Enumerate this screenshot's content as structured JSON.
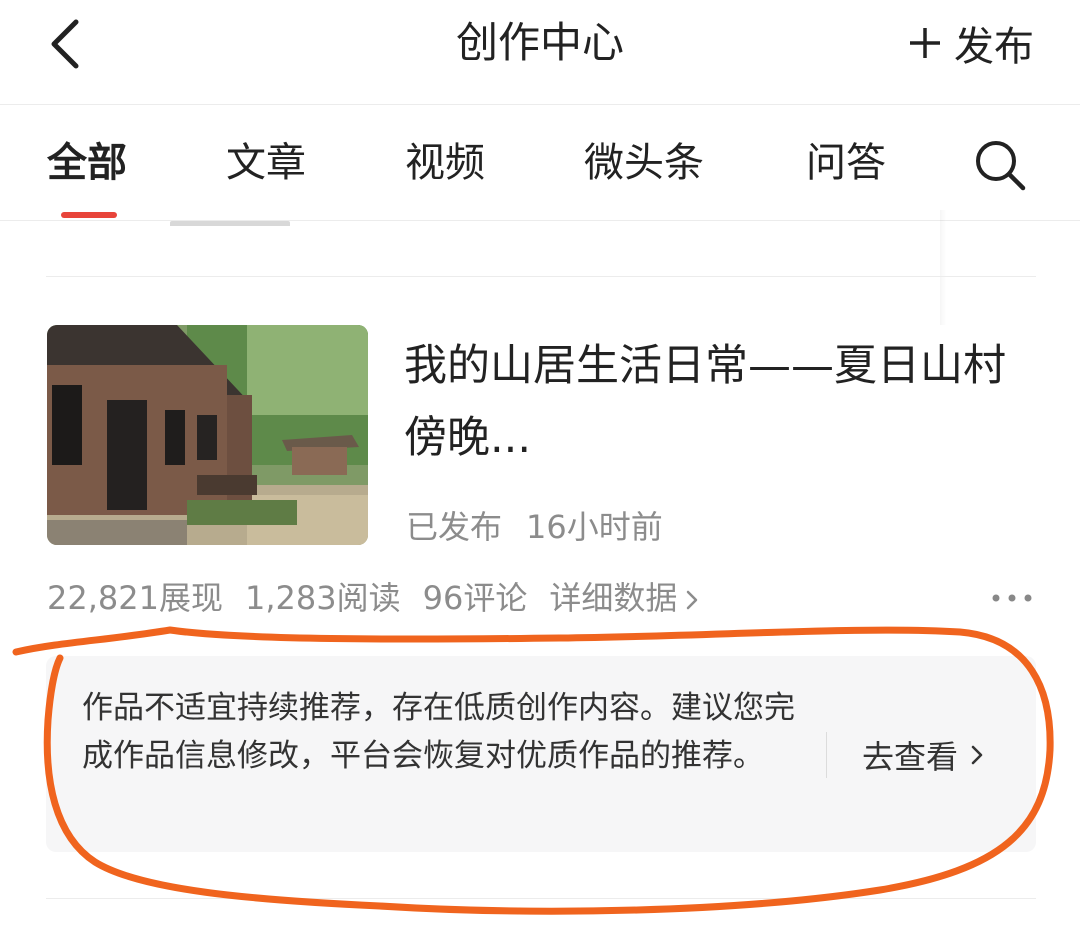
{
  "header": {
    "title": "创作中心",
    "publish_label": "发布"
  },
  "tabs": [
    {
      "label": "全部",
      "active": true
    },
    {
      "label": "文章",
      "active": false
    },
    {
      "label": "视频",
      "active": false
    },
    {
      "label": "微头条",
      "active": false
    },
    {
      "label": "问答",
      "active": false
    }
  ],
  "article": {
    "title": "我的山居生活日常——夏日山村傍晚...",
    "status": "已发布",
    "time": "16小时前",
    "stats": {
      "impressions": "22,821展现",
      "reads": "1,283阅读",
      "comments": "96评论",
      "detail_link": "详细数据"
    }
  },
  "notice": {
    "text": "作品不适宜持续推荐，存在低质创作内容。建议您完成作品信息修改，平台会恢复对优质作品的推荐。",
    "action_label": "去查看"
  },
  "colors": {
    "accent": "#e8443a",
    "annotation": "#f0641e",
    "muted_text": "#8c8c8c"
  },
  "icons": [
    "back-icon",
    "plus-icon",
    "search-icon",
    "more-icon",
    "chevron-right-icon"
  ]
}
